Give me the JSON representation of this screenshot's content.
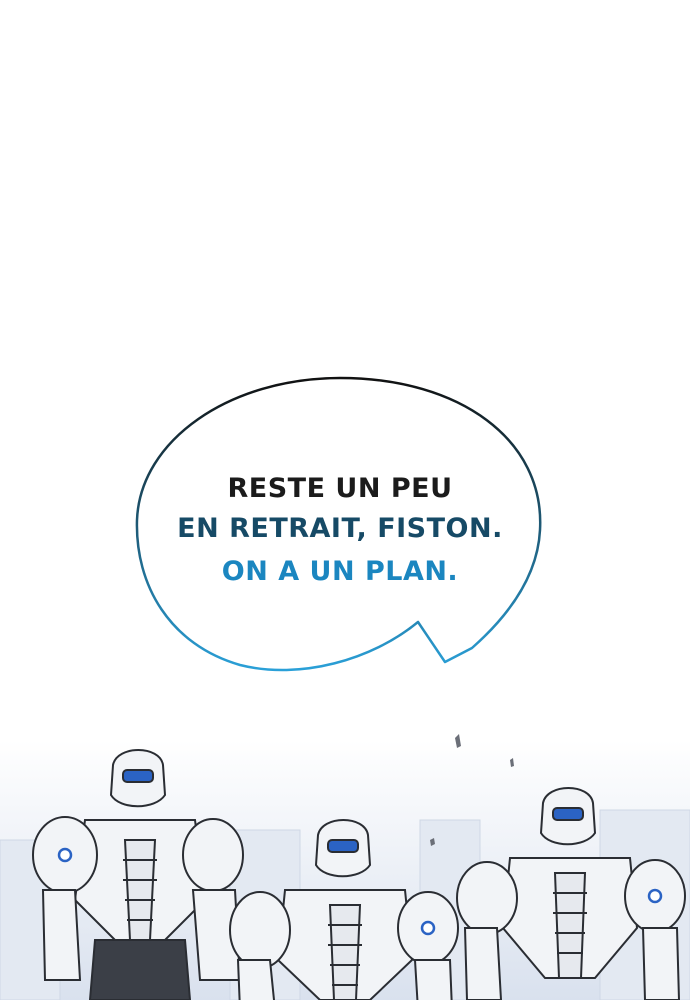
{
  "speech_bubble": {
    "lines": [
      {
        "text": "RESTE UN PEU",
        "color": "#1b1b1b"
      },
      {
        "text": "EN RETRAIT, FISTON.",
        "color": "#164a66"
      },
      {
        "text": "ON A UN PLAN.",
        "color": "#1b86c0"
      }
    ],
    "outline_gradient": [
      "#111111",
      "#2aa0d8"
    ]
  },
  "scene": {
    "subject": "robot-soldiers",
    "robot_count": 3,
    "armor_color": "#f2f4f7",
    "visor_color": "#2b63c4"
  }
}
